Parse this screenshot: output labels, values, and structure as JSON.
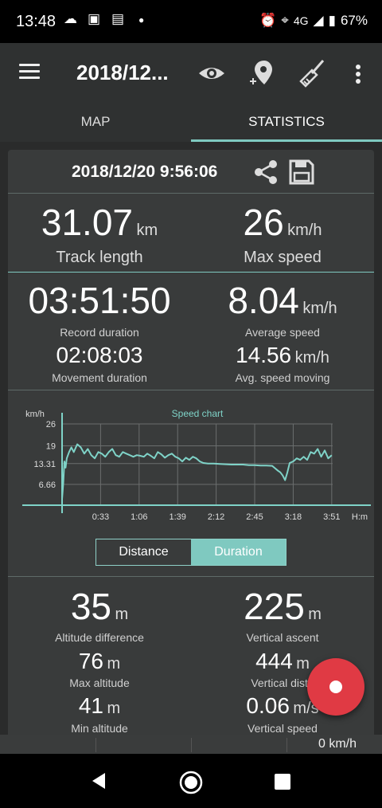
{
  "status_bar": {
    "time": "13:48",
    "network": "4G",
    "battery": "67%"
  },
  "app_bar": {
    "title": "2018/12..."
  },
  "tabs": [
    {
      "label": "MAP"
    },
    {
      "label": "STATISTICS"
    }
  ],
  "header": {
    "date": "2018/12/20 9:56:06"
  },
  "stats": {
    "track_length": {
      "value": "31.07",
      "unit": "km",
      "label": "Track length"
    },
    "max_speed": {
      "value": "26",
      "unit": "km/h",
      "label": "Max speed"
    },
    "record_duration": {
      "value": "03:51:50",
      "label": "Record duration"
    },
    "average_speed": {
      "value": "8.04",
      "unit": "km/h",
      "label": "Average speed"
    },
    "movement_duration": {
      "value": "02:08:03",
      "label": "Movement duration"
    },
    "avg_speed_moving": {
      "value": "14.56",
      "unit": "km/h",
      "label": "Avg. speed moving"
    },
    "altitude_difference": {
      "value": "35",
      "unit": "m",
      "label": "Altitude difference"
    },
    "vertical_ascent": {
      "value": "225",
      "unit": "m",
      "label": "Vertical ascent"
    },
    "max_altitude": {
      "value": "76",
      "unit": "m",
      "label": "Max altitude"
    },
    "vertical_distance": {
      "value": "444",
      "unit": "m",
      "label": "Vertical dista"
    },
    "min_altitude": {
      "value": "41",
      "unit": "m",
      "label": "Min altitude"
    },
    "vertical_speed": {
      "value": "0.06",
      "unit": "m/s",
      "label": "Vertical speed"
    }
  },
  "toggle": {
    "distance": "Distance",
    "duration": "Duration",
    "selected": "Duration"
  },
  "bottom_strip": {
    "value": "0 km/h"
  },
  "chart_data": {
    "type": "line",
    "title": "Speed chart",
    "ylabel": "km/h",
    "xlabel": "H:m",
    "y_ticks": [
      "26",
      "19",
      "13.31",
      "6.66"
    ],
    "x_ticks": [
      "0:33",
      "1:06",
      "1:39",
      "2:12",
      "2:45",
      "3:18",
      "3:51"
    ],
    "ylim": [
      0,
      26
    ],
    "xlim": [
      0,
      231.8
    ],
    "series": [
      {
        "color": "#7fd3c8",
        "x": [
          0,
          1,
          2,
          3,
          4,
          6,
          8,
          10,
          13,
          16,
          19,
          22,
          25,
          28,
          31,
          34,
          37,
          40,
          43,
          46,
          49,
          52,
          55,
          58,
          61,
          64,
          67,
          70,
          73,
          76,
          79,
          82,
          85,
          88,
          91,
          94,
          97,
          100,
          103,
          106,
          109,
          112,
          115,
          118,
          121,
          125,
          130,
          135,
          140,
          145,
          150,
          155,
          160,
          165,
          170,
          175,
          180,
          185,
          187,
          189,
          191,
          193,
          195,
          198,
          201,
          204,
          207,
          210,
          213,
          216,
          219,
          222,
          225,
          228,
          231
        ],
        "y": [
          2,
          7,
          14,
          12,
          15,
          17,
          18.5,
          17,
          19.5,
          18.5,
          16.5,
          18,
          16,
          15,
          17,
          16.5,
          15.5,
          17,
          18,
          16,
          15.5,
          17,
          16.5,
          16,
          15.5,
          16,
          15.8,
          15.5,
          16.5,
          15.8,
          15,
          17,
          16.3,
          15.2,
          16,
          16.5,
          15.5,
          15,
          14,
          15.2,
          14.5,
          15.5,
          15,
          14,
          13.5,
          13.3,
          13.3,
          13.2,
          13.1,
          13,
          13,
          13,
          12.8,
          12.8,
          12.7,
          12.7,
          12.6,
          11,
          10.5,
          9.5,
          8,
          10.5,
          13.5,
          14,
          15,
          14.5,
          15.5,
          14.5,
          17,
          16.5,
          18,
          15.5,
          17.5,
          15,
          16
        ]
      }
    ]
  }
}
